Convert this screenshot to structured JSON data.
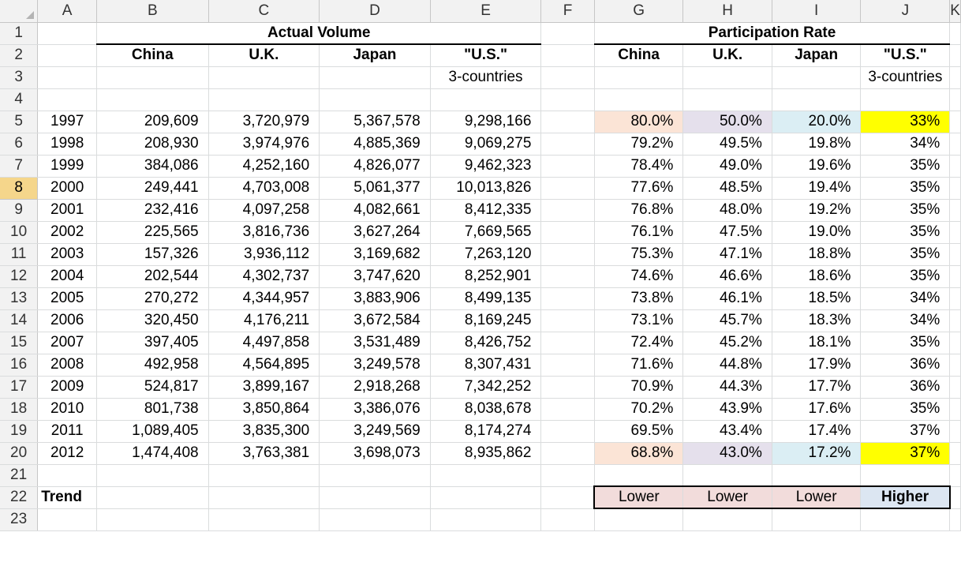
{
  "columns": [
    "A",
    "B",
    "C",
    "D",
    "E",
    "F",
    "G",
    "H",
    "I",
    "J",
    "K"
  ],
  "row_numbers": [
    "1",
    "2",
    "3",
    "4",
    "5",
    "6",
    "7",
    "8",
    "9",
    "10",
    "11",
    "12",
    "13",
    "14",
    "15",
    "16",
    "17",
    "18",
    "19",
    "20",
    "21",
    "22",
    "23"
  ],
  "headers": {
    "actual_volume": "Actual Volume",
    "participation_rate": "Participation Rate",
    "china": "China",
    "uk": "U.K.",
    "japan": "Japan",
    "us": "\"U.S.\"",
    "three_countries": "3-countries"
  },
  "rows": [
    {
      "year": "1997",
      "china": "209,609",
      "uk": "3,720,979",
      "japan": "5,367,578",
      "us": "9,298,166",
      "pc": "80.0%",
      "pu": "50.0%",
      "pj": "20.0%",
      "pus": "33%"
    },
    {
      "year": "1998",
      "china": "208,930",
      "uk": "3,974,976",
      "japan": "4,885,369",
      "us": "9,069,275",
      "pc": "79.2%",
      "pu": "49.5%",
      "pj": "19.8%",
      "pus": "34%"
    },
    {
      "year": "1999",
      "china": "384,086",
      "uk": "4,252,160",
      "japan": "4,826,077",
      "us": "9,462,323",
      "pc": "78.4%",
      "pu": "49.0%",
      "pj": "19.6%",
      "pus": "35%"
    },
    {
      "year": "2000",
      "china": "249,441",
      "uk": "4,703,008",
      "japan": "5,061,377",
      "us": "10,013,826",
      "pc": "77.6%",
      "pu": "48.5%",
      "pj": "19.4%",
      "pus": "35%"
    },
    {
      "year": "2001",
      "china": "232,416",
      "uk": "4,097,258",
      "japan": "4,082,661",
      "us": "8,412,335",
      "pc": "76.8%",
      "pu": "48.0%",
      "pj": "19.2%",
      "pus": "35%"
    },
    {
      "year": "2002",
      "china": "225,565",
      "uk": "3,816,736",
      "japan": "3,627,264",
      "us": "7,669,565",
      "pc": "76.1%",
      "pu": "47.5%",
      "pj": "19.0%",
      "pus": "35%"
    },
    {
      "year": "2003",
      "china": "157,326",
      "uk": "3,936,112",
      "japan": "3,169,682",
      "us": "7,263,120",
      "pc": "75.3%",
      "pu": "47.1%",
      "pj": "18.8%",
      "pus": "35%"
    },
    {
      "year": "2004",
      "china": "202,544",
      "uk": "4,302,737",
      "japan": "3,747,620",
      "us": "8,252,901",
      "pc": "74.6%",
      "pu": "46.6%",
      "pj": "18.6%",
      "pus": "35%"
    },
    {
      "year": "2005",
      "china": "270,272",
      "uk": "4,344,957",
      "japan": "3,883,906",
      "us": "8,499,135",
      "pc": "73.8%",
      "pu": "46.1%",
      "pj": "18.5%",
      "pus": "34%"
    },
    {
      "year": "2006",
      "china": "320,450",
      "uk": "4,176,211",
      "japan": "3,672,584",
      "us": "8,169,245",
      "pc": "73.1%",
      "pu": "45.7%",
      "pj": "18.3%",
      "pus": "34%"
    },
    {
      "year": "2007",
      "china": "397,405",
      "uk": "4,497,858",
      "japan": "3,531,489",
      "us": "8,426,752",
      "pc": "72.4%",
      "pu": "45.2%",
      "pj": "18.1%",
      "pus": "35%"
    },
    {
      "year": "2008",
      "china": "492,958",
      "uk": "4,564,895",
      "japan": "3,249,578",
      "us": "8,307,431",
      "pc": "71.6%",
      "pu": "44.8%",
      "pj": "17.9%",
      "pus": "36%"
    },
    {
      "year": "2009",
      "china": "524,817",
      "uk": "3,899,167",
      "japan": "2,918,268",
      "us": "7,342,252",
      "pc": "70.9%",
      "pu": "44.3%",
      "pj": "17.7%",
      "pus": "36%"
    },
    {
      "year": "2010",
      "china": "801,738",
      "uk": "3,850,864",
      "japan": "3,386,076",
      "us": "8,038,678",
      "pc": "70.2%",
      "pu": "43.9%",
      "pj": "17.6%",
      "pus": "35%"
    },
    {
      "year": "2011",
      "china": "1,089,405",
      "uk": "3,835,300",
      "japan": "3,249,569",
      "us": "8,174,274",
      "pc": "69.5%",
      "pu": "43.4%",
      "pj": "17.4%",
      "pus": "37%"
    },
    {
      "year": "2012",
      "china": "1,474,408",
      "uk": "3,763,381",
      "japan": "3,698,073",
      "us": "8,935,862",
      "pc": "68.8%",
      "pu": "43.0%",
      "pj": "17.2%",
      "pus": "37%"
    }
  ],
  "trend": {
    "label": "Trend",
    "china": "Lower",
    "uk": "Lower",
    "japan": "Lower",
    "us": "Higher"
  },
  "colors": {
    "china_highlight": "#fbe4d6",
    "uk_highlight": "#e5e0ec",
    "japan_highlight": "#dbeef4",
    "us_highlight": "#ffff00",
    "trend_lower": "#f2dcdb",
    "trend_higher": "#dce6f2",
    "active_header": "#f5d68b"
  }
}
